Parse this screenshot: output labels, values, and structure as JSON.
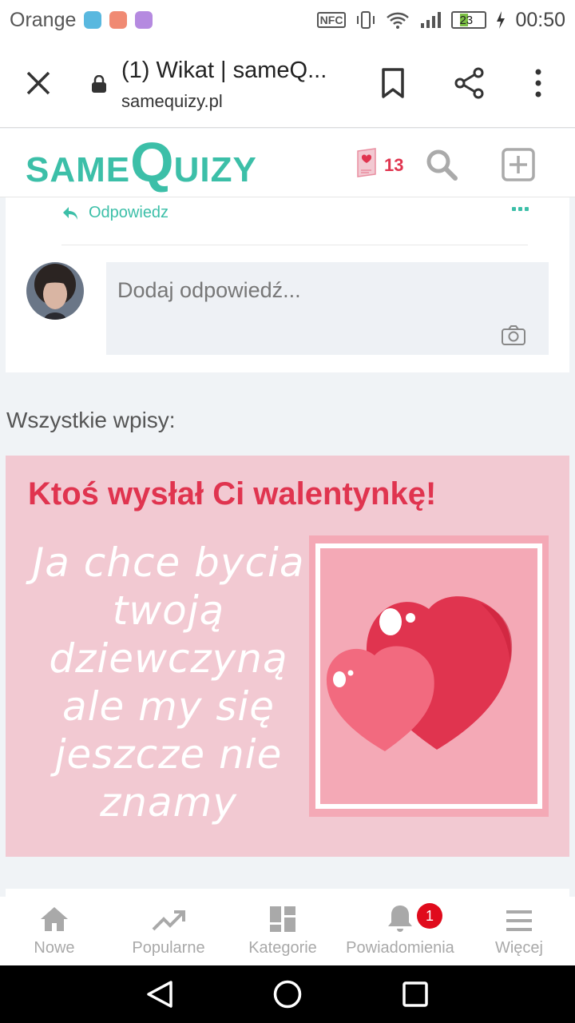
{
  "status_bar": {
    "carrier": "Orange",
    "nfc": "NFC",
    "battery": "23",
    "time": "00:50"
  },
  "browser": {
    "title": "(1) Wikat | sameQ...",
    "url": "samequizy.pl"
  },
  "site_header": {
    "logo_small_1": "SAME",
    "logo_big": "Q",
    "logo_small_2": "UIZY",
    "valentine_count": "13"
  },
  "comment": {
    "reply_label": "Odpowiedz",
    "reply_placeholder": "Dodaj odpowiedź..."
  },
  "entries": {
    "title": "Wszystkie wpisy:"
  },
  "valentine": {
    "title": "Ktoś wysłał Ci walentynkę!",
    "message": "Ja chce bycia twoją dziewczyną ale my się jeszcze nie znamy"
  },
  "bottom_nav": {
    "items": [
      {
        "label": "Nowe",
        "icon": "home-icon"
      },
      {
        "label": "Popularne",
        "icon": "trending-icon"
      },
      {
        "label": "Kategorie",
        "icon": "categories-icon"
      },
      {
        "label": "Powiadomienia",
        "icon": "bell-icon",
        "badge": "1"
      },
      {
        "label": "Więcej",
        "icon": "menu-icon"
      }
    ]
  },
  "colors": {
    "brand": "#3cbfa8",
    "accent": "#e0344f",
    "banner_bg": "#f2c9d2"
  }
}
